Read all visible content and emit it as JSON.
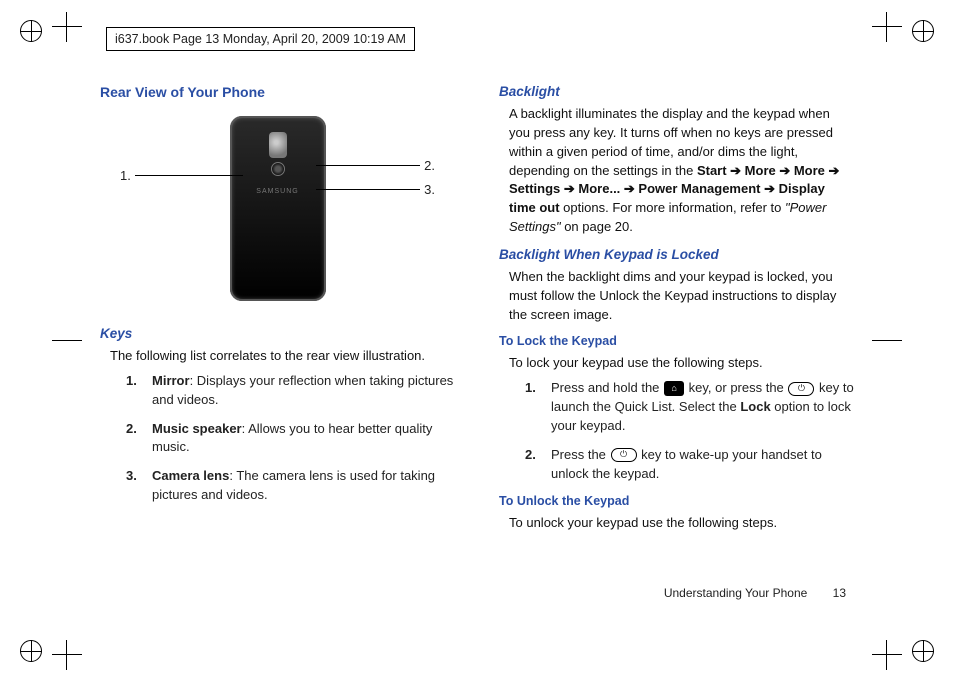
{
  "header_note": "i637.book  Page 13  Monday, April 20, 2009  10:19 AM",
  "left": {
    "h1": "Rear View of Your Phone",
    "callouts": {
      "c1": "1.",
      "c2": "2.",
      "c3": "3."
    },
    "phone_brand": "SAMSUNG",
    "h2_keys": "Keys",
    "keys_intro": "The following list correlates to the rear view illustration.",
    "items": [
      {
        "n": "1.",
        "label": "Mirror",
        "text": ": Displays your reflection when taking pictures and videos."
      },
      {
        "n": "2.",
        "label": "Music speaker",
        "text": ": Allows you to hear better quality music."
      },
      {
        "n": "3.",
        "label": "Camera lens",
        "text": ": The camera lens is used for taking pictures and videos."
      }
    ]
  },
  "right": {
    "h_backlight": "Backlight",
    "backlight_p1a": "A backlight illuminates the display and the keypad when you press any key. It turns off when no keys are pressed within a given period of time, and/or dims the light, depending on the settings in the ",
    "backlight_path": "Start ➔ More ➔ More ➔ Settings ➔ More... ➔ Power Management ➔ Display time out",
    "backlight_p1b": " options. For more information, refer to ",
    "ref_italic": "\"Power Settings\"",
    "backlight_p1c": "  on page 20.",
    "h_backlight_locked": "Backlight When Keypad is Locked",
    "locked_p": "When the backlight dims and your keypad is locked, you must follow the Unlock the Keypad instructions to display the screen image.",
    "h_lock": "To Lock the Keypad",
    "lock_intro": "To lock your keypad use the following steps.",
    "lock_steps": [
      {
        "n": "1.",
        "a": "Press and hold the ",
        "b": " key, or press the ",
        "c": " key to launch the Quick List. Select the ",
        "lock_bold": "Lock",
        "d": " option to lock your keypad."
      },
      {
        "n": "2.",
        "a": "Press the ",
        "b": " key to wake-up your handset to unlock the keypad."
      }
    ],
    "h_unlock": "To Unlock the Keypad",
    "unlock_intro": "To unlock your keypad use the following steps."
  },
  "footer": {
    "section": "Understanding Your Phone",
    "page": "13"
  }
}
